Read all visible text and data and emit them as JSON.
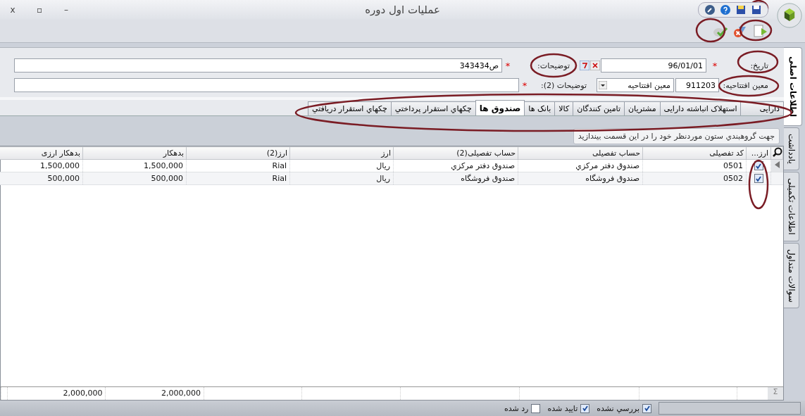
{
  "window": {
    "title": "عملیات اول دوره"
  },
  "window_controls": [
    "–",
    "▫",
    "x"
  ],
  "highlight_ellipses": true,
  "form": {
    "date_label": "تاریخ:",
    "date_value": "96/01/01",
    "desc_label": "توضیحات:",
    "desc_value": "ص343434",
    "account_label": "معین افتتاحیه:",
    "account_code": "911203",
    "account_name": "معین افتتاحیه",
    "desc2_label": "توضیحات (2):",
    "required_mark": "*"
  },
  "tabs": [
    {
      "label": "دارایی",
      "selected": false
    },
    {
      "label": "استهلاک انباشته دارایی",
      "selected": false
    },
    {
      "label": "مشتریان",
      "selected": false
    },
    {
      "label": "تامین کنندگان",
      "selected": false
    },
    {
      "label": "کالا",
      "selected": false
    },
    {
      "label": "بانک ها",
      "selected": false
    },
    {
      "label": "صندوق ها",
      "selected": true
    },
    {
      "label": "چکهاي استقرار پرداختي",
      "selected": false
    },
    {
      "label": "چکهاي استقرار دريافتي",
      "selected": false
    }
  ],
  "group_hint": "جهت گروهبندي ستون موردنظر خود را در اين قسمت بيندازيد",
  "table": {
    "check_column": "ارز...",
    "columns": [
      "کد تفصیلی",
      "حساب تفصیلی",
      "حساب تفصیلی(2)",
      "ارز",
      "ارز(2)",
      "بدهکار",
      "بدهکار ارزی"
    ],
    "rows": [
      {
        "checked": true,
        "cells": [
          "0501",
          "صندوق دفتر مرکزي",
          "صندوق دفتر مرکزي",
          "ریال",
          "Rial",
          "1,500,000",
          "1,500,000"
        ]
      },
      {
        "checked": true,
        "cells": [
          "0502",
          "صندوق فروشگاه",
          "صندوق فروشگاه",
          "ریال",
          "Rial",
          "500,000",
          "500,000"
        ]
      }
    ],
    "totals": [
      "2,000,000",
      "2,000,000"
    ],
    "sum_sign": "Σ"
  },
  "side_tabs": [
    {
      "label": "اطلاعات اصلی",
      "selected": true
    },
    {
      "label": "يادداشت",
      "selected": false
    },
    {
      "label": "اطلاعات تکمیلی",
      "selected": false
    },
    {
      "label": "سوالات متداول",
      "selected": false
    }
  ],
  "status_filters": [
    {
      "label": "بررسي نشده",
      "checked": true
    },
    {
      "label": "تاييد شده",
      "checked": true
    },
    {
      "label": "رد شده",
      "checked": false
    }
  ]
}
